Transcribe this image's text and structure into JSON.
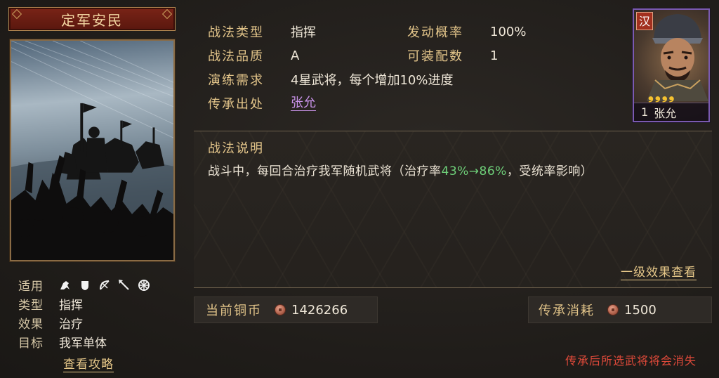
{
  "skill": {
    "name": "定军安民",
    "applicable_label": "适用",
    "unit_icons": [
      "cavalry-icon",
      "shield-icon",
      "archer-icon",
      "spear-icon",
      "siege-wheel-icon"
    ],
    "type_label": "类型",
    "type_value": "指挥",
    "effect_label": "效果",
    "effect_value": "治疗",
    "target_label": "目标",
    "target_value": "我军单体",
    "guide_link": "查看攻略"
  },
  "info": {
    "type_label": "战法类型",
    "type_value": "指挥",
    "trigger_label": "发动概率",
    "trigger_value": "100%",
    "quality_label": "战法品质",
    "quality_value": "A",
    "slots_label": "可装配数",
    "slots_value": "1",
    "requirement_label": "演练需求",
    "requirement_value": "4星武将，每个增加10%进度",
    "source_label": "传承出处",
    "source_value": "张允"
  },
  "general": {
    "faction": "汉",
    "stars": [
      "❟",
      "❟",
      "❟",
      "❟"
    ],
    "star_count": 4,
    "level": "1",
    "name": "张允"
  },
  "description": {
    "title": "战法说明",
    "text_before": "战斗中，每回合治疗我军随机武将（治疗率",
    "text_highlight": "43%→86%",
    "text_after": "，受统率影响）",
    "effect_link": "一级效果查看"
  },
  "currency": {
    "label": "当前铜币",
    "value": "1426266"
  },
  "cost": {
    "label": "传承消耗",
    "value": "1500"
  },
  "warning": "传承后所选武将将会消失",
  "colors": {
    "gold_label": "#e3c58a",
    "highlight_green": "#6fd17a",
    "warning_red": "#e04a3a",
    "link_purple": "#c892e8",
    "title_bar": "#7a2417"
  }
}
